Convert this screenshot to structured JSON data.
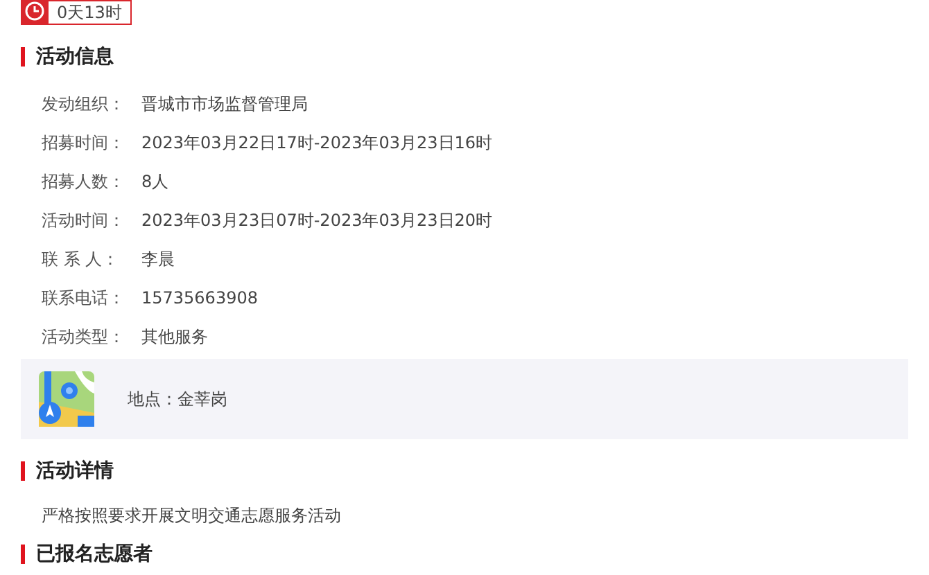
{
  "countdown": "0天13时",
  "info_section": {
    "title": "活动信息",
    "fields": [
      {
        "label": "发动组织：",
        "value": "晋城市市场监督管理局"
      },
      {
        "label": "招募时间：",
        "value": "2023年03月22日17时-2023年03月23日16时"
      },
      {
        "label": "招募人数：",
        "value": "8人"
      },
      {
        "label": "活动时间：",
        "value": "2023年03月23日07时-2023年03月23日20时"
      },
      {
        "label": "联 系 人：",
        "value": "李晨"
      },
      {
        "label": "联系电话：",
        "value": "15735663908"
      },
      {
        "label": "活动类型：",
        "value": "其他服务"
      }
    ]
  },
  "location": "地点：金莘岗",
  "detail_section": {
    "title": "活动详情",
    "text": "严格按照要求开展文明交通志愿服务活动"
  },
  "volunteers_section": {
    "title": "已报名志愿者"
  }
}
